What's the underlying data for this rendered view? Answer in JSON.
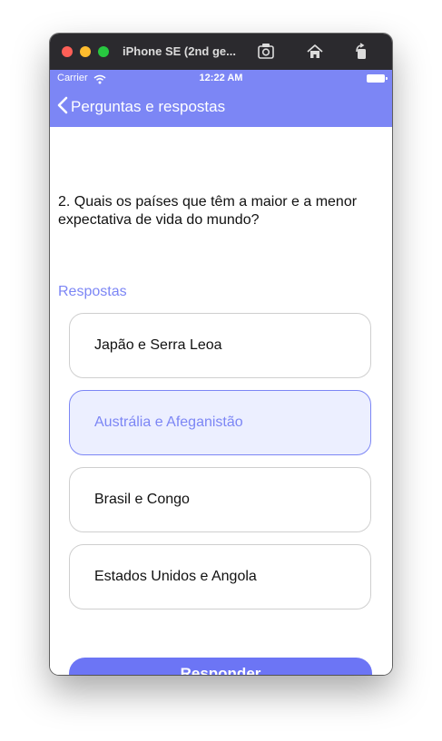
{
  "window": {
    "title": "iPhone SE (2nd ge...",
    "toolbar_icons": [
      "screenshot-icon",
      "home-icon",
      "rotate-icon"
    ]
  },
  "status_bar": {
    "carrier": "Carrier",
    "time": "12:22 AM"
  },
  "nav": {
    "back_label": "Perguntas e respostas"
  },
  "question": {
    "text": "2. Quais os países que têm a maior e a menor expectativa de vida do mundo?"
  },
  "answers": {
    "section_label": "Respostas",
    "options": [
      {
        "label": "Japão e Serra Leoa",
        "selected": false
      },
      {
        "label": "Austrália e Afeganistão",
        "selected": true
      },
      {
        "label": "Brasil e Congo",
        "selected": false
      },
      {
        "label": "Estados Unidos e Angola",
        "selected": false
      }
    ]
  },
  "submit": {
    "label": "Responder"
  },
  "colors": {
    "accent": "#7c86f5",
    "button": "#6c75f5",
    "selected_bg": "#ecefff"
  }
}
